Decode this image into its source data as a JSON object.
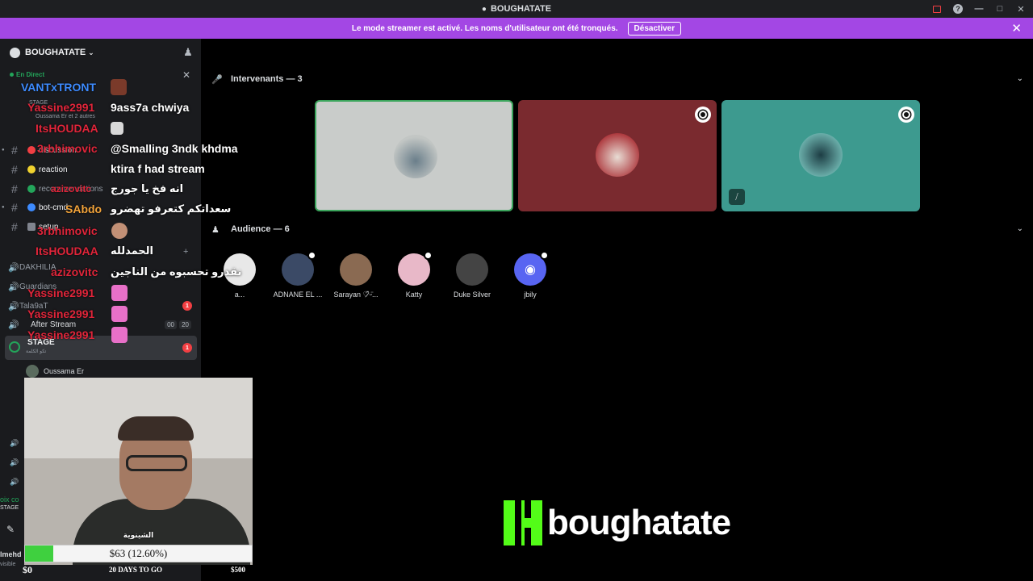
{
  "window": {
    "title": "BOUGHATATE"
  },
  "banner": {
    "text": "Le mode streamer est activé. Les noms d'utilisateur ont été tronqués.",
    "button": "Désactiver"
  },
  "sidebar": {
    "server_name": "BOUGHATATE",
    "live_label": "En Direct",
    "live_channel": "STAGE",
    "live_users": "Oussama Er et 2 autres",
    "channels": [
      {
        "name": "discussion",
        "color": "#f23f43"
      },
      {
        "name": "reaction",
        "color": "#f0d22e"
      },
      {
        "name": "recommendations",
        "color": "#23a55a"
      },
      {
        "name": "bot-cmd",
        "color": "#3d8bff"
      },
      {
        "name": "setup",
        "color": ""
      }
    ],
    "voice_channels": [
      {
        "name": "DAKHILIA"
      },
      {
        "name": "Guardians"
      },
      {
        "name": "Tala9aT",
        "badge": "1"
      },
      {
        "name": "After Stream",
        "counter_a": "00",
        "counter_b": "20"
      }
    ],
    "stage_name": "STAGE",
    "stage_sub": "تكو الكلمة",
    "stage_badge": "1",
    "stage_user": "Oussama Er",
    "bottom_cut_1": "oix co",
    "bottom_cut_2": "STAGE",
    "bottom_cut_3": "lmehd",
    "bottom_cut_4": "visible"
  },
  "main": {
    "speakers_header": "Intervenants — 3",
    "audience_header": "Audience — 6",
    "speakers": [
      {
        "bg": "#c9ccca",
        "border": "#3ba55c",
        "avatar": "#8a8f8c",
        "mod": false,
        "muted": false
      },
      {
        "bg": "#7a2a2f",
        "border": "",
        "avatar": "#c8b4a8",
        "mod": true,
        "muted": false
      },
      {
        "bg": "#3d9a8f",
        "border": "",
        "avatar": "#2e6f72",
        "mod": true,
        "muted": true
      }
    ],
    "audience": [
      {
        "name": "a...",
        "color": "#e8e8e8",
        "mini": false
      },
      {
        "name": "ADNANE EL ...",
        "color": "#3b4a66",
        "mini": true
      },
      {
        "name": "Sarayan ♡̷᷈ᵕ̈...",
        "color": "#8a6a52",
        "mini": false
      },
      {
        "name": "Katty",
        "color": "#e8b8c8",
        "mini": true
      },
      {
        "name": "Duke Silver",
        "color": "#444444",
        "mini": false
      },
      {
        "name": "jbily",
        "color": "#5865f2",
        "mini": true
      }
    ]
  },
  "chat": [
    {
      "user": "VANTxTRONT",
      "style": "blue",
      "msg": ""
    },
    {
      "user": "Yassine2991",
      "style": "",
      "msg": "9ass7a chwiya"
    },
    {
      "user": "ItsHOUDAA",
      "style": "",
      "msg": ""
    },
    {
      "user": "3rbhimovic",
      "style": "",
      "msg": "@Smalling 3ndk khdma"
    },
    {
      "user": "",
      "style": "",
      "msg": "ktira f had stream"
    },
    {
      "user": "azizovitc",
      "style": "",
      "msg": "انه فخ يا جورج"
    },
    {
      "user": "SAbdo",
      "style": "orange",
      "msg": "سعداتكم كتعرفو تهضرو"
    },
    {
      "user": "3rbhimovic",
      "style": "",
      "msg": ""
    },
    {
      "user": "ItsHOUDAA",
      "style": "",
      "msg": "الحمدلله"
    },
    {
      "user": "azizovitc",
      "style": "",
      "msg": "نقدرو تحسبوه من الناجين"
    },
    {
      "user": "Yassine2991",
      "style": "",
      "msg": ""
    },
    {
      "user": "Yassine2991",
      "style": "",
      "msg": ""
    },
    {
      "user": "Yassine2991",
      "style": "",
      "msg": ""
    }
  ],
  "webcam": {
    "caption": "الشينوية"
  },
  "goal": {
    "amount": "$63 (12.60%)",
    "progress": 0.126,
    "start": "$0",
    "days": "20 DAYS TO GO",
    "target": "$500"
  },
  "brand": {
    "name": "boughatate",
    "color": "#53fc18"
  }
}
